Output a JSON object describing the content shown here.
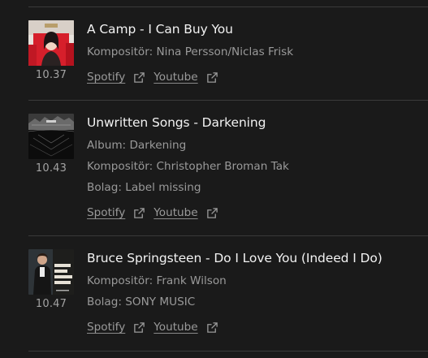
{
  "tracks": [
    {
      "title": "A Camp - I Can Buy You",
      "time": "10.37",
      "meta": [
        "Kompositör: Nina Persson/Niclas Frisk"
      ],
      "links": [
        "Spotify",
        "Youtube"
      ],
      "cover_text": "A CAMP"
    },
    {
      "title": "Unwritten Songs - Darkening",
      "time": "10.43",
      "meta": [
        "Album: Darkening",
        "Kompositör: Christopher Broman Tak",
        "Bolag: Label missing"
      ],
      "links": [
        "Spotify",
        "Youtube"
      ]
    },
    {
      "title": "Bruce Springsteen - Do I Love You (Indeed I Do)",
      "time": "10.47",
      "meta": [
        "Kompositör: Frank Wilson",
        "Bolag: SONY MUSIC"
      ],
      "links": [
        "Spotify",
        "Youtube"
      ],
      "cover_text": "ONLY THE STRONG SURVIVE"
    }
  ],
  "icons": {
    "external_link": "external-link-icon"
  },
  "colors": {
    "background": "#1a1a1a",
    "title": "#f2f2f2",
    "meta": "#9a9a9a",
    "divider": "#3a3a3a"
  }
}
